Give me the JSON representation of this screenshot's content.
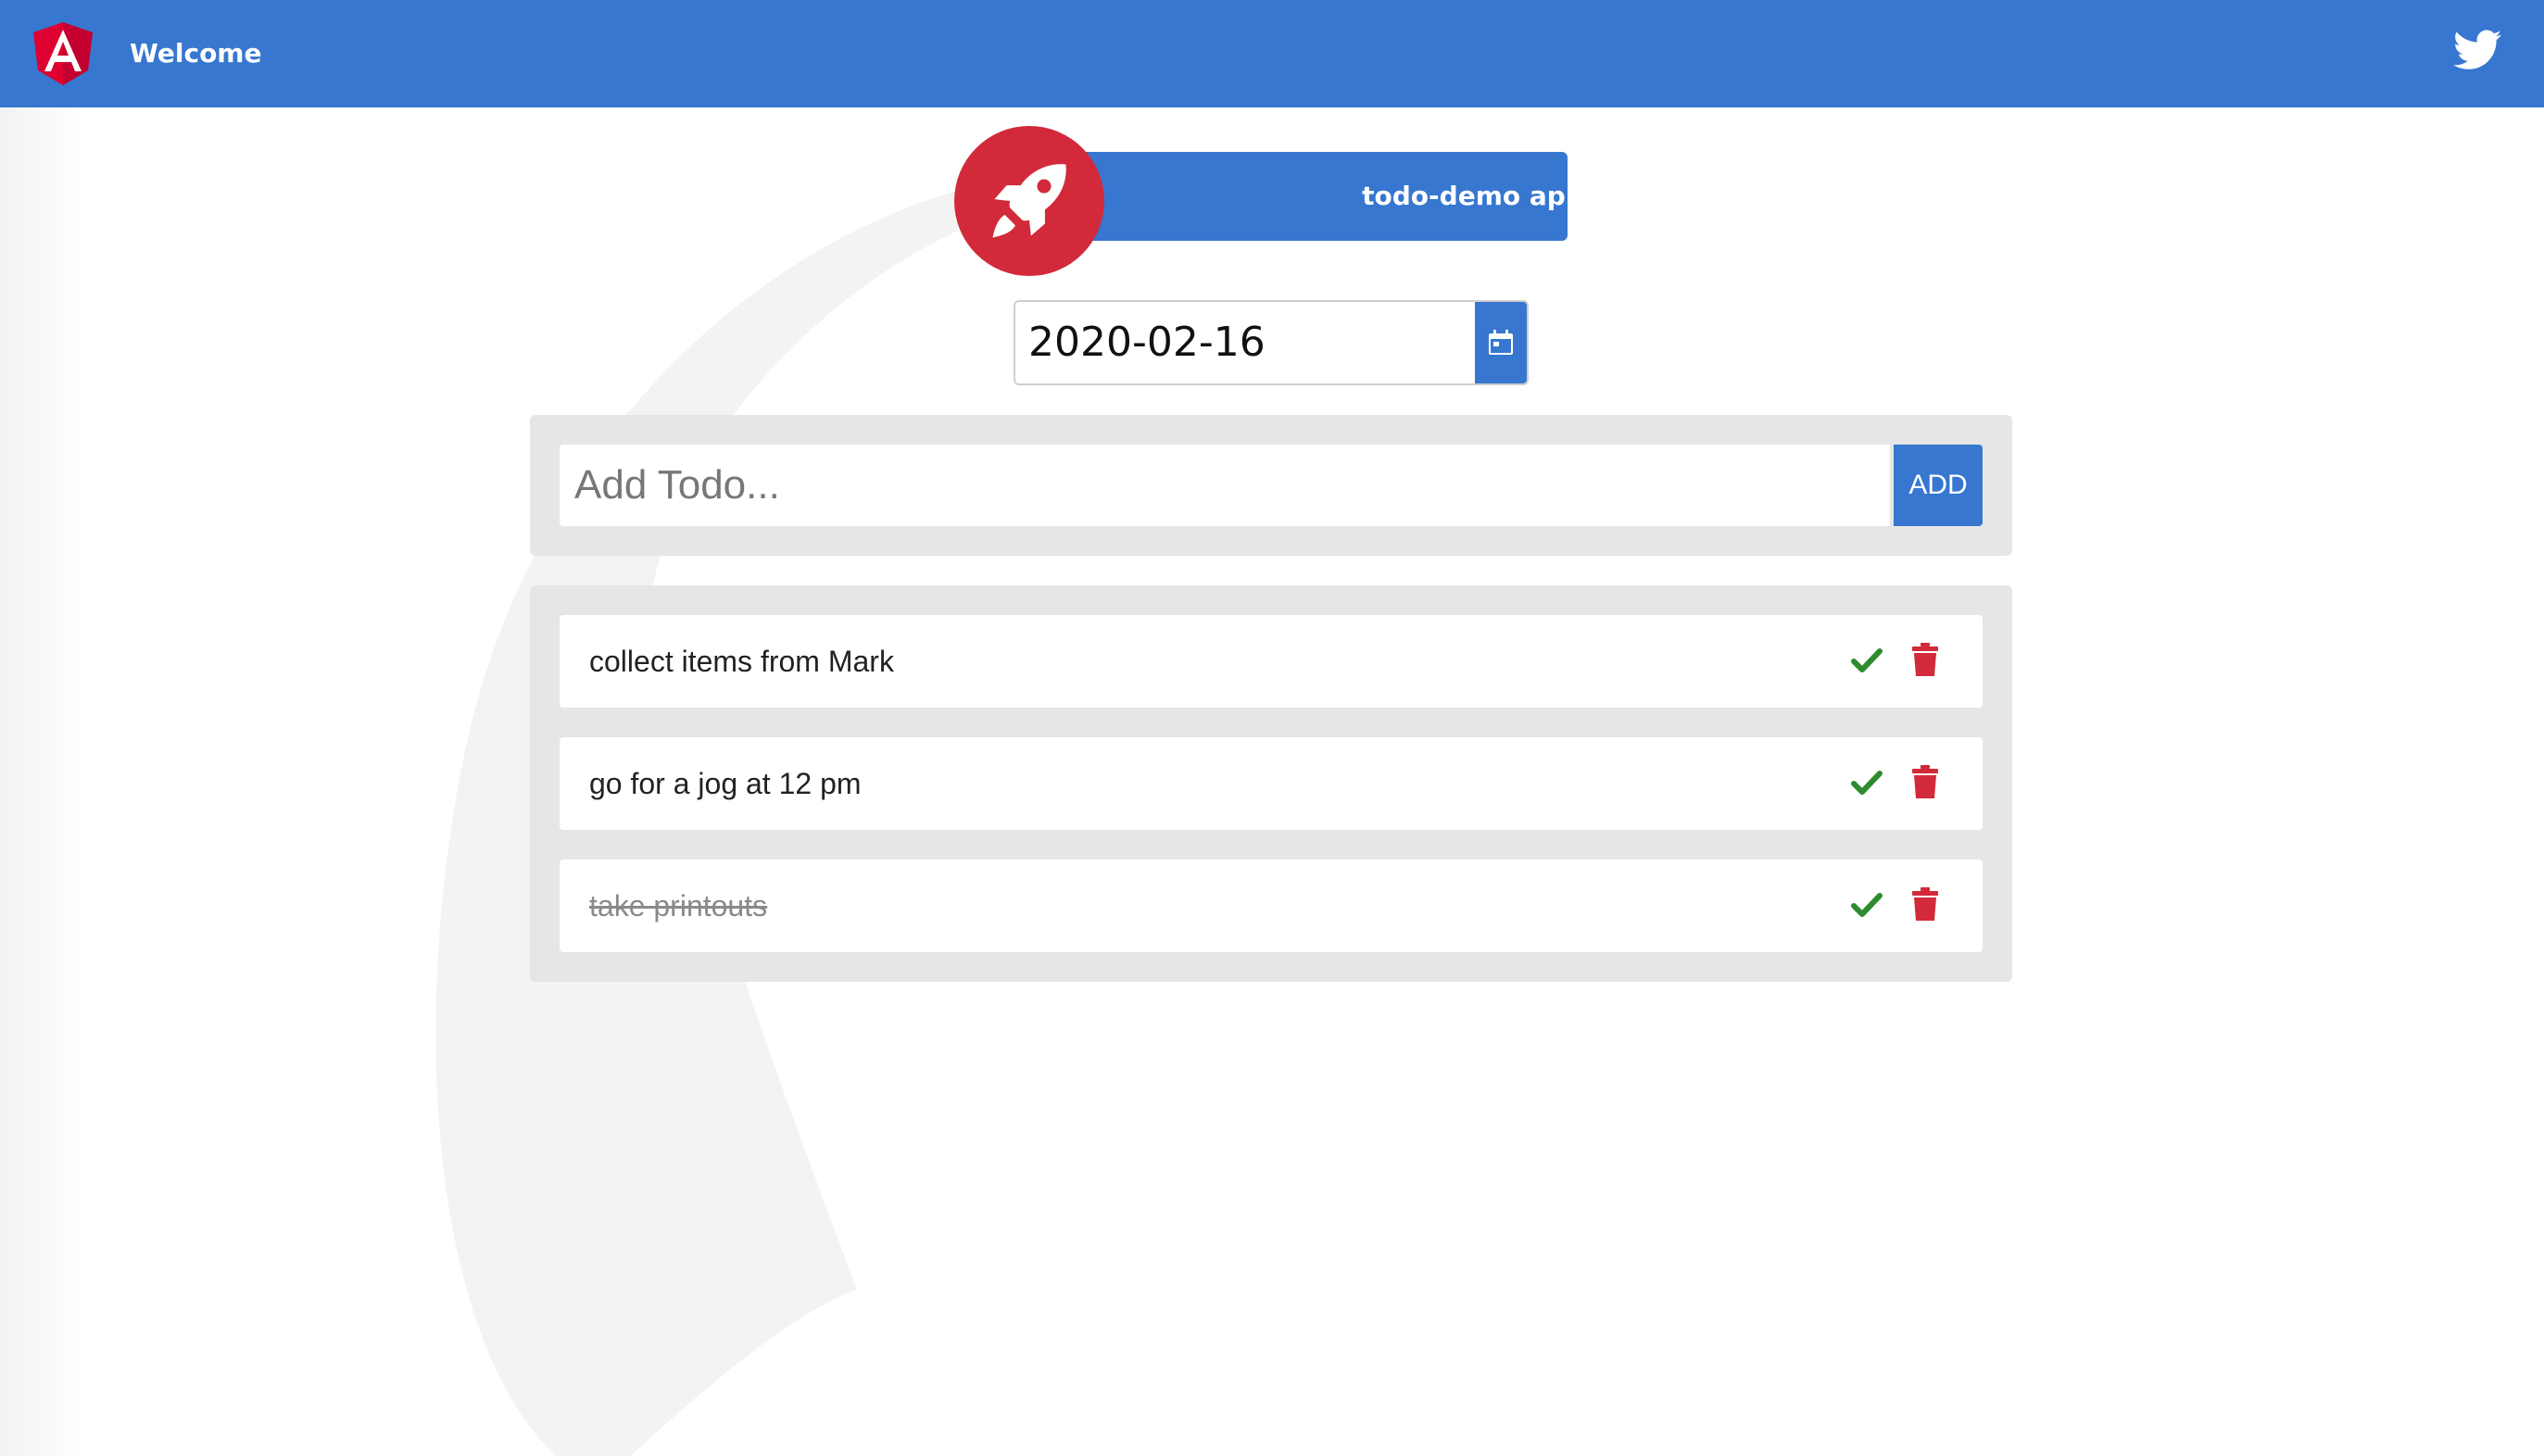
{
  "toolbar": {
    "title": "Welcome",
    "logo_icon": "angular-logo-icon",
    "twitter_icon": "twitter-icon"
  },
  "banner": {
    "text": "todo-demo app is running!",
    "icon": "rocket-icon"
  },
  "date_picker": {
    "value": "2020-02-16",
    "icon": "calendar-icon"
  },
  "add_todo": {
    "placeholder": "Add Todo...",
    "button_label": "ADD"
  },
  "todos": [
    {
      "text": "collect items from Mark",
      "completed": false
    },
    {
      "text": "go for a jog at 12 pm",
      "completed": false
    },
    {
      "text": "take printouts",
      "completed": true
    }
  ],
  "colors": {
    "primary": "#3777cf",
    "danger": "#d22a3a",
    "success": "#2e8b2e",
    "panel": "#e6e6e6"
  }
}
